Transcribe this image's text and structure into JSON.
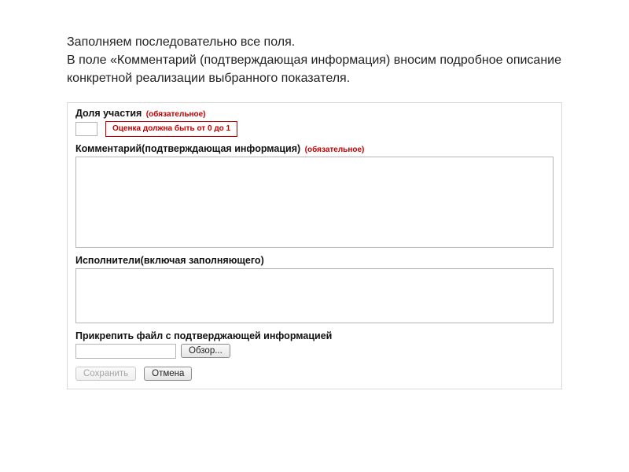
{
  "instruction": "Заполняем последовательно все поля.\nВ поле «Комментарий (подтверждающая информация) вносим подробное описание конкретной реализации выбранного показателя.",
  "form": {
    "share": {
      "label": "Доля участия",
      "required_text": "(обязательное)",
      "value": "",
      "warning": "Оценка должна быть от 0 до 1"
    },
    "comment": {
      "label": "Комментарий(подтверждающая информация)",
      "required_text": "(обязательное)",
      "value": ""
    },
    "performers": {
      "label": "Исполнители(включая заполняющего)",
      "value": ""
    },
    "attach": {
      "label": "Прикрепить файл с подтверджающей информацией",
      "file_value": "",
      "browse_label": "Обзор..."
    },
    "buttons": {
      "save": "Сохранить",
      "cancel": "Отмена"
    }
  }
}
